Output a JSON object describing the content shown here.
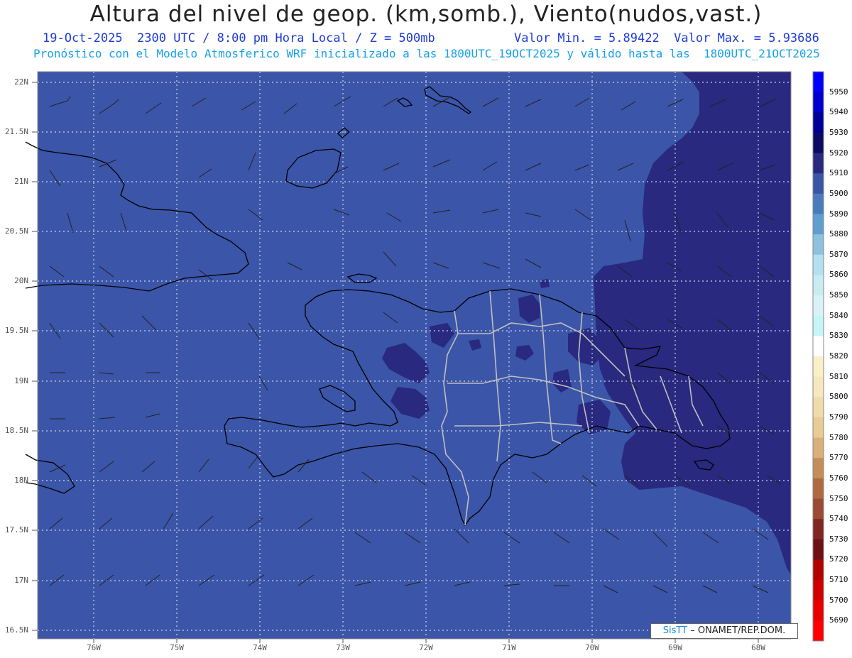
{
  "title": "Altura del nivel de geop. (km,somb.), Viento(nudos,vast.)",
  "subtitle_left": "19-Oct-2025  2300 UTC / 8:00 pm Hora Local / Z = 500mb",
  "subtitle_right": "Valor Min. = 5.89422  Valor Max. = 5.93686",
  "model_info": "Pronóstico con el Modelo Atmosferico WRF inicializado a las 1800UTC_19OCT2025 y válido hasta las  1800UTC_21OCT2025",
  "lat_labels": [
    "22N",
    "21.5N",
    "21N",
    "20.5N",
    "20N",
    "19.5N",
    "19N",
    "18.5N",
    "18N",
    "17.5N",
    "17N",
    "16.5N"
  ],
  "lon_labels": [
    "76W",
    "75W",
    "74W",
    "73W",
    "72W",
    "71W",
    "70W",
    "69W",
    "68W"
  ],
  "colorbar": {
    "labels": [
      "5950",
      "5940",
      "5930",
      "5920",
      "5910",
      "5900",
      "5890",
      "5880",
      "5870",
      "5860",
      "5850",
      "5840",
      "5830",
      "5820",
      "5810",
      "5800",
      "5790",
      "5780",
      "5770",
      "5760",
      "5750",
      "5740",
      "5730",
      "5720",
      "5710",
      "5700",
      "5690"
    ],
    "colors": [
      "#0000ff",
      "#0000cc",
      "#000099",
      "#0b0b66",
      "#28297f",
      "#3b55a8",
      "#4a7cbc",
      "#5f9fd0",
      "#8ec0e0",
      "#b3e0ee",
      "#c8ecf3",
      "#d8f3f8",
      "#c6f5f7",
      "#ffffff",
      "#faf0c8",
      "#f6e7bf",
      "#efdcab",
      "#e8cb95",
      "#d9b07a",
      "#c48e59",
      "#b06a41",
      "#9b4a33",
      "#822622",
      "#6e0f14",
      "#b30000",
      "#d10000",
      "#e80000",
      "#ff0000"
    ]
  },
  "fill_colors": {
    "ocean_base": "#3b55a8",
    "high_region": "#28297f",
    "coast": "#000000",
    "province_border": "#bfbfbf"
  },
  "credit": {
    "brand": "SisTT",
    "suffix": "– ONAMET/REP.DOM."
  }
}
